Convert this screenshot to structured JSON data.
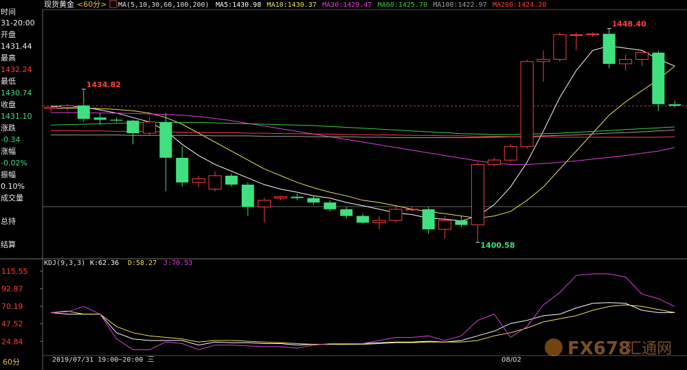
{
  "header": {
    "instrument": "现货黄金",
    "period": "<60分>",
    "ma_params": "MA(5,10,30,60,100,200)",
    "ma_values": [
      {
        "label": "MA5:1430.98",
        "color": "#ffffff"
      },
      {
        "label": "MA10:1430.37",
        "color": "#f0e060"
      },
      {
        "label": "MA30:1429.47",
        "color": "#e040e0"
      },
      {
        "label": "MA60:1425.70",
        "color": "#40d040"
      },
      {
        "label": "MA100:1422.97",
        "color": "#a0a0a0"
      },
      {
        "label": "MA200:1424.20",
        "color": "#ff4040"
      }
    ]
  },
  "side_panel": {
    "time_label": "时间",
    "time_value": "31-20:00",
    "open_label": "开盘",
    "open_value": "1431.44",
    "high_label": "最高",
    "high_value": "1432.24",
    "low_label": "最低",
    "low_value": "1430.74",
    "close_label": "收盘",
    "close_value": "1431.10",
    "change_label": "涨跌",
    "change_value": "-0.34",
    "pct_label": "涨幅",
    "pct_value": "-0.02%",
    "amp_label": "振幅",
    "amp_value": "0.10%",
    "vol_label": "成交量",
    "vol_value": "",
    "pos_label": "总持",
    "pos_value": "",
    "settle_label": "结算",
    "settle_value": ""
  },
  "kdj": {
    "params": "KDJ(9,3,3)",
    "k_label": "K:62.36",
    "d_label": "D:58.27",
    "j_label": "J:70.53",
    "k_color": "#ffffff",
    "d_color": "#f0e060",
    "j_color": "#e040e0",
    "ticks": [
      "115.55",
      "92.87",
      "70.19",
      "47.52",
      "24.84"
    ]
  },
  "footer": {
    "cursor_time": "2019/07/31 19:00~20:00 三",
    "date_label": "08/02",
    "tab": "60分",
    "watermark": "FX678",
    "watermark_cn": "汇通网"
  },
  "colors": {
    "up": "#ff4040",
    "down": "#40e080",
    "background": "#000000",
    "text_up": "#ff4040",
    "text_down": "#40e080"
  },
  "chart_data": {
    "type": "candlestick",
    "price_ylim": [
      1398,
      1452
    ],
    "annotations": [
      {
        "label": "1434.82",
        "value": 1434.82,
        "index": 2
      },
      {
        "label": "1448.40",
        "value": 1448.4,
        "index": 34
      },
      {
        "label": "1400.58",
        "value": 1400.58,
        "index": 26
      }
    ],
    "last_price": 1431.1,
    "candles": [
      {
        "o": 1430.5,
        "h": 1431.0,
        "l": 1429.8,
        "c": 1430.8
      },
      {
        "o": 1430.8,
        "h": 1431.5,
        "l": 1430.0,
        "c": 1431.2
      },
      {
        "o": 1431.2,
        "h": 1434.82,
        "l": 1427.5,
        "c": 1428.2
      },
      {
        "o": 1428.5,
        "h": 1429.5,
        "l": 1426.8,
        "c": 1428.0
      },
      {
        "o": 1428.0,
        "h": 1428.5,
        "l": 1427.5,
        "c": 1427.8
      },
      {
        "o": 1427.8,
        "h": 1428.0,
        "l": 1422.5,
        "c": 1425.0
      },
      {
        "o": 1425.0,
        "h": 1428.5,
        "l": 1424.5,
        "c": 1427.5
      },
      {
        "o": 1427.5,
        "h": 1429.5,
        "l": 1412.0,
        "c": 1419.5
      },
      {
        "o": 1419.5,
        "h": 1422.0,
        "l": 1413.0,
        "c": 1414.0
      },
      {
        "o": 1414.0,
        "h": 1415.5,
        "l": 1413.0,
        "c": 1414.8
      },
      {
        "o": 1412.5,
        "h": 1416.5,
        "l": 1412.0,
        "c": 1415.5
      },
      {
        "o": 1415.5,
        "h": 1416.0,
        "l": 1413.0,
        "c": 1413.5
      },
      {
        "o": 1413.5,
        "h": 1414.0,
        "l": 1406.5,
        "c": 1408.5
      },
      {
        "o": 1408.5,
        "h": 1410.5,
        "l": 1405.0,
        "c": 1410.0
      },
      {
        "o": 1410.5,
        "h": 1411.0,
        "l": 1410.0,
        "c": 1410.8
      },
      {
        "o": 1410.8,
        "h": 1411.5,
        "l": 1410.0,
        "c": 1410.5
      },
      {
        "o": 1410.5,
        "h": 1411.0,
        "l": 1409.0,
        "c": 1409.5
      },
      {
        "o": 1409.5,
        "h": 1410.0,
        "l": 1407.5,
        "c": 1408.0
      },
      {
        "o": 1408.0,
        "h": 1408.5,
        "l": 1406.0,
        "c": 1406.5
      },
      {
        "o": 1406.5,
        "h": 1407.0,
        "l": 1404.8,
        "c": 1405.0
      },
      {
        "o": 1405.0,
        "h": 1406.5,
        "l": 1403.5,
        "c": 1405.5
      },
      {
        "o": 1405.5,
        "h": 1408.5,
        "l": 1405.0,
        "c": 1408.0
      },
      {
        "o": 1408.0,
        "h": 1408.5,
        "l": 1407.5,
        "c": 1408.0
      },
      {
        "o": 1408.0,
        "h": 1408.5,
        "l": 1402.5,
        "c": 1403.5
      },
      {
        "o": 1403.5,
        "h": 1406.5,
        "l": 1401.5,
        "c": 1405.5
      },
      {
        "o": 1405.5,
        "h": 1406.5,
        "l": 1404.0,
        "c": 1404.5
      },
      {
        "o": 1404.5,
        "h": 1418.5,
        "l": 1400.58,
        "c": 1418.0
      },
      {
        "o": 1418.0,
        "h": 1419.5,
        "l": 1417.5,
        "c": 1419.0
      },
      {
        "o": 1419.0,
        "h": 1422.5,
        "l": 1418.5,
        "c": 1422.0
      },
      {
        "o": 1422.0,
        "h": 1441.5,
        "l": 1421.5,
        "c": 1441.0
      },
      {
        "o": 1441.0,
        "h": 1443.5,
        "l": 1436.5,
        "c": 1441.5
      },
      {
        "o": 1441.5,
        "h": 1447.5,
        "l": 1441.0,
        "c": 1447.0
      },
      {
        "o": 1447.0,
        "h": 1447.5,
        "l": 1443.5,
        "c": 1447.0
      },
      {
        "o": 1447.0,
        "h": 1447.5,
        "l": 1446.5,
        "c": 1447.2
      },
      {
        "o": 1447.2,
        "h": 1448.4,
        "l": 1439.5,
        "c": 1440.5
      },
      {
        "o": 1440.5,
        "h": 1442.5,
        "l": 1439.0,
        "c": 1441.5
      },
      {
        "o": 1441.5,
        "h": 1443.0,
        "l": 1440.0,
        "c": 1443.0
      },
      {
        "o": 1443.0,
        "h": 1443.5,
        "l": 1430.0,
        "c": 1431.5
      },
      {
        "o": 1431.44,
        "h": 1432.24,
        "l": 1430.74,
        "c": 1431.1
      }
    ],
    "ma_series": [
      {
        "key": "ma5",
        "color": "#ffffff",
        "values": [
          1431.0,
          1431.0,
          1430.8,
          1430.2,
          1429.5,
          1428.5,
          1427.5,
          1425.5,
          1422.5,
          1420.0,
          1418.0,
          1416.5,
          1415.0,
          1413.5,
          1412.5,
          1411.8,
          1411.0,
          1410.5,
          1409.5,
          1408.8,
          1408.0,
          1407.2,
          1406.8,
          1406.0,
          1405.8,
          1405.4,
          1406.5,
          1409.0,
          1413.0,
          1418.5,
          1425.5,
          1433.0,
          1439.0,
          1443.5,
          1444.5,
          1444.0,
          1443.5,
          1441.5,
          1440.0
        ]
      },
      {
        "key": "ma10",
        "color": "#f0e060",
        "values": [
          1430.5,
          1430.6,
          1430.6,
          1430.5,
          1430.3,
          1430.0,
          1429.5,
          1428.5,
          1427.0,
          1425.0,
          1423.0,
          1421.0,
          1419.0,
          1417.0,
          1415.5,
          1414.0,
          1412.8,
          1411.8,
          1411.0,
          1410.0,
          1409.5,
          1408.8,
          1408.0,
          1407.5,
          1407.0,
          1406.5,
          1406.0,
          1406.5,
          1407.5,
          1410.0,
          1413.0,
          1417.0,
          1421.0,
          1425.0,
          1429.0,
          1432.0,
          1434.5,
          1437.0,
          1440.0
        ]
      },
      {
        "key": "ma30",
        "color": "#e040e0",
        "values": [
          1429.6,
          1429.6,
          1429.6,
          1429.5,
          1429.5,
          1429.4,
          1429.3,
          1429.2,
          1429.0,
          1428.7,
          1428.3,
          1427.8,
          1427.2,
          1426.6,
          1426.0,
          1425.4,
          1424.8,
          1424.2,
          1423.6,
          1423.0,
          1422.4,
          1421.8,
          1421.2,
          1420.6,
          1420.0,
          1419.4,
          1418.8,
          1418.3,
          1418.0,
          1418.0,
          1418.2,
          1418.5,
          1418.8,
          1419.2,
          1419.6,
          1420.0,
          1420.5,
          1421.0,
          1421.8
        ]
      },
      {
        "key": "ma60",
        "color": "#40d040",
        "values": [
          1426.8,
          1426.9,
          1427.0,
          1427.1,
          1427.2,
          1427.3,
          1427.4,
          1427.4,
          1427.4,
          1427.4,
          1427.3,
          1427.2,
          1427.1,
          1427.0,
          1426.9,
          1426.8,
          1426.7,
          1426.5,
          1426.3,
          1426.1,
          1425.9,
          1425.7,
          1425.5,
          1425.3,
          1425.1,
          1424.9,
          1424.8,
          1424.7,
          1424.7,
          1424.8,
          1424.9,
          1425.0,
          1425.2,
          1425.4,
          1425.6,
          1425.8,
          1426.0,
          1426.2,
          1426.4
        ]
      },
      {
        "key": "ma100",
        "color": "#a0a0a0",
        "values": [
          1424.6,
          1424.6,
          1424.6,
          1424.6,
          1424.6,
          1424.5,
          1424.5,
          1424.5,
          1424.5,
          1424.5,
          1424.4,
          1424.4,
          1424.4,
          1424.3,
          1424.3,
          1424.3,
          1424.2,
          1424.2,
          1424.2,
          1424.1,
          1424.1,
          1424.0,
          1424.0,
          1424.0,
          1424.0,
          1424.0,
          1424.0,
          1424.1,
          1424.2,
          1424.3,
          1424.4,
          1424.5,
          1424.6,
          1424.8,
          1425.0,
          1425.1,
          1425.3,
          1425.5,
          1425.7
        ]
      },
      {
        "key": "ma200",
        "color": "#ff4040",
        "values": [
          1425.6,
          1425.6,
          1425.5,
          1425.5,
          1425.4,
          1425.4,
          1425.3,
          1425.3,
          1425.2,
          1425.2,
          1425.1,
          1425.1,
          1425.0,
          1425.0,
          1424.9,
          1424.9,
          1424.8,
          1424.8,
          1424.7,
          1424.7,
          1424.6,
          1424.6,
          1424.5,
          1424.5,
          1424.4,
          1424.4,
          1424.3,
          1424.3,
          1424.2,
          1424.2,
          1424.2,
          1424.1,
          1424.1,
          1424.1,
          1424.1,
          1424.1,
          1424.1,
          1424.1,
          1424.2
        ]
      }
    ],
    "kdj_ylim": [
      10,
      120
    ],
    "kdj_series": [
      {
        "key": "K",
        "color": "#ffffff",
        "values": [
          62,
          60,
          60,
          60,
          36,
          28,
          26,
          26,
          26,
          20,
          24,
          23,
          23,
          22,
          22,
          20,
          21,
          21,
          21,
          22,
          23,
          24,
          24,
          25,
          24,
          26,
          32,
          38,
          48,
          52,
          58,
          60,
          68,
          74,
          75,
          74,
          65,
          62,
          62
        ]
      },
      {
        "key": "D",
        "color": "#f0e060",
        "values": [
          62,
          64,
          60,
          60,
          44,
          36,
          32,
          30,
          28,
          24,
          26,
          26,
          25,
          24,
          23,
          22,
          21,
          21,
          21,
          21,
          22,
          23,
          23,
          24,
          24,
          24,
          26,
          32,
          36,
          42,
          50,
          54,
          58,
          65,
          70,
          72,
          70,
          66,
          62
        ]
      },
      {
        "key": "J",
        "color": "#e040e0",
        "values": [
          62,
          63,
          70,
          60,
          28,
          14,
          14,
          24,
          22,
          14,
          20,
          20,
          19,
          18,
          18,
          16,
          20,
          22,
          22,
          22,
          26,
          30,
          30,
          32,
          26,
          32,
          52,
          60,
          30,
          44,
          72,
          88,
          110,
          112,
          112,
          108,
          86,
          80,
          70
        ]
      }
    ]
  }
}
